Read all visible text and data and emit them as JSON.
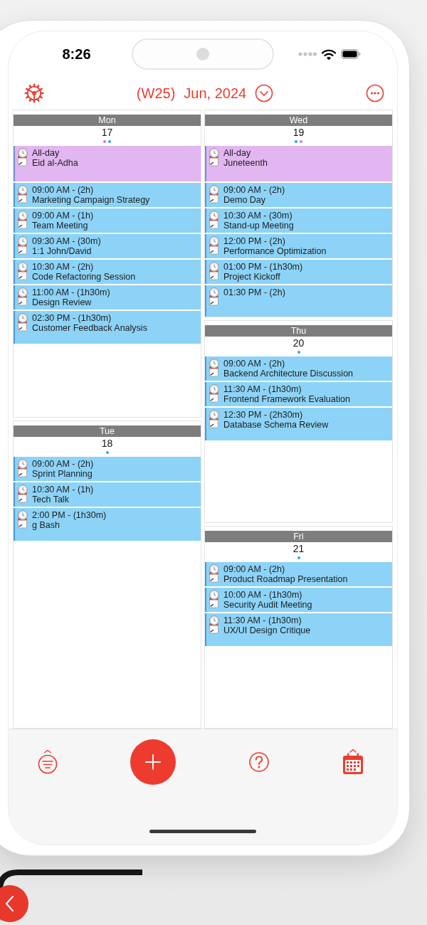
{
  "status_bar": {
    "time": "8:26"
  },
  "header": {
    "week": "(W25)",
    "month": "Jun, 2024"
  },
  "columns": [
    {
      "days": [
        {
          "name": "Mon",
          "date": "17",
          "dots": [
            {
              "color": "#c27ee3"
            },
            {
              "color": "#2ea6ea"
            }
          ],
          "events": [
            {
              "kind": "all_day",
              "color": "#e2b6f0",
              "time": "All-day",
              "title": "Eid al-Adha"
            },
            {
              "kind": "timed",
              "color": "#8cd3f7",
              "time": "09:00 AM - (2h)",
              "title": "Marketing Campaign Strategy"
            },
            {
              "kind": "timed",
              "color": "#8cd3f7",
              "time": "09:00 AM - (1h)",
              "title": "Team Meeting"
            },
            {
              "kind": "timed",
              "color": "#8cd3f7",
              "time": "09:30 AM - (30m)",
              "title": "1:1 John/David"
            },
            {
              "kind": "timed",
              "color": "#8cd3f7",
              "time": "10:30 AM - (2h)",
              "title": "Code Refactoring Session"
            },
            {
              "kind": "timed",
              "color": "#8cd3f7",
              "time": "11:00 AM - (1h30m)",
              "title": "Design Review"
            },
            {
              "kind": "timed",
              "color": "#8cd3f7",
              "time": "02:30 PM - (1h30m)",
              "title": "Customer Feedback Analysis"
            }
          ]
        },
        {
          "name": "Tue",
          "date": "18",
          "dots": [
            {
              "color": "#2ea6ea"
            }
          ],
          "events": [
            {
              "kind": "timed",
              "color": "#8cd3f7",
              "time": "09:00 AM - (2h)",
              "title": "Sprint Planning"
            },
            {
              "kind": "timed",
              "color": "#8cd3f7",
              "time": "10:30 AM - (1h)",
              "title": "Tech Talk"
            },
            {
              "kind": "timed",
              "color": "#8cd3f7",
              "time": "2:00 PM - (1h30m)",
              "title": "g Bash"
            }
          ]
        }
      ]
    },
    {
      "days": [
        {
          "name": "Wed",
          "date": "19",
          "dots": [
            {
              "color": "#2ea6ea"
            },
            {
              "color": "#c27ee3"
            }
          ],
          "events": [
            {
              "kind": "all_day",
              "color": "#e2b6f0",
              "time": "All-day",
              "title": "Juneteenth"
            },
            {
              "kind": "timed",
              "color": "#8cd3f7",
              "time": "09:00 AM - (2h)",
              "title": "Demo Day"
            },
            {
              "kind": "timed",
              "color": "#8cd3f7",
              "time": "10:30 AM - (30m)",
              "title": "Stand-up Meeting"
            },
            {
              "kind": "timed",
              "color": "#8cd3f7",
              "time": "12:00 PM - (2h)",
              "title": "Performance Optimization"
            },
            {
              "kind": "timed",
              "color": "#8cd3f7",
              "time": "01:00 PM - (1h30m)",
              "title": "Project Kickoff"
            },
            {
              "kind": "timed",
              "color": "#8cd3f7",
              "time": "01:30 PM - (2h)"
            }
          ]
        },
        {
          "name": "Thu",
          "date": "20",
          "dots": [
            {
              "color": "#2ea6ea"
            }
          ],
          "events": [
            {
              "kind": "timed",
              "color": "#8cd3f7",
              "time": "09:00 AM - (2h)",
              "title": "Backend Architecture Discussion"
            },
            {
              "kind": "timed",
              "color": "#8cd3f7",
              "time": "11:30 AM - (1h30m)",
              "title": "Frontend Framework Evaluation"
            },
            {
              "kind": "timed",
              "color": "#8cd3f7",
              "time": "12:30 PM - (2h30m)",
              "title": "Database Schema Review"
            }
          ]
        },
        {
          "name": "Fri",
          "date": "21",
          "dots": [
            {
              "color": "#2ea6ea"
            }
          ],
          "events": [
            {
              "kind": "timed",
              "color": "#8cd3f7",
              "time": "09:00 AM - (2h)",
              "title": "Product Roadmap Presentation"
            },
            {
              "kind": "timed",
              "color": "#8cd3f7",
              "time": "10:00 AM - (1h30m)",
              "title": "Security Audit Meeting"
            },
            {
              "kind": "timed",
              "color": "#8cd3f7",
              "time": "11:30 AM - (1h30m)",
              "title": "UX/UI Design Critique"
            }
          ]
        }
      ]
    }
  ]
}
